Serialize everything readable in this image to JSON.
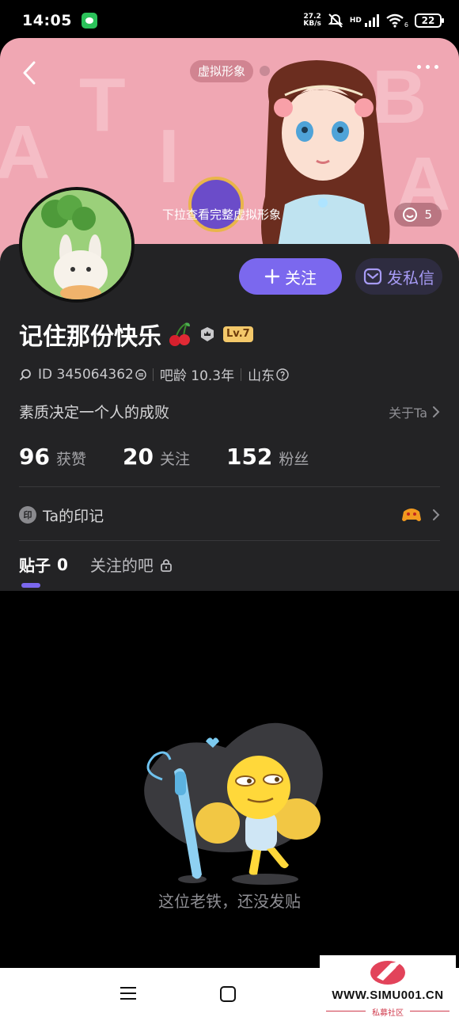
{
  "status_bar": {
    "time": "14:05",
    "net_speed_value": "27.2",
    "net_speed_unit": "KB/s",
    "network_type": "HD",
    "wifi_sub": "6",
    "battery": "22"
  },
  "banner": {
    "avatar_tag": "虚拟形象",
    "pull_hint": "下拉查看完整虚拟形象",
    "like_count": "5",
    "bg_letters": [
      "A",
      "T",
      "I",
      "B",
      "A"
    ]
  },
  "profile": {
    "follow_label": "关注",
    "dm_label": "发私信",
    "username": "记住那份快乐",
    "level": "Lv.7",
    "id_text": "ID 345064362",
    "bar_age": "吧龄 10.3年",
    "location": "山东",
    "bio": "素质决定一个人的成败",
    "about_label": "关于Ta",
    "stats": [
      {
        "num": "96",
        "label": "获赞"
      },
      {
        "num": "20",
        "label": "关注"
      },
      {
        "num": "152",
        "label": "粉丝"
      }
    ],
    "mark_icon_char": "印",
    "mark_label": "Ta的印记"
  },
  "tabs": {
    "posts_label": "贴子",
    "posts_count": "0",
    "followed_bars_label": "关注的吧"
  },
  "empty_state": {
    "message": "这位老铁，还没发贴"
  },
  "watermark": {
    "url": "WWW.SIMU001.CN",
    "subtitle": "私募社区"
  },
  "colors": {
    "accent": "#7b68ee",
    "banner_bg": "#f0a7b3",
    "card_bg": "#232325",
    "level_badge": "#f3c86a"
  }
}
